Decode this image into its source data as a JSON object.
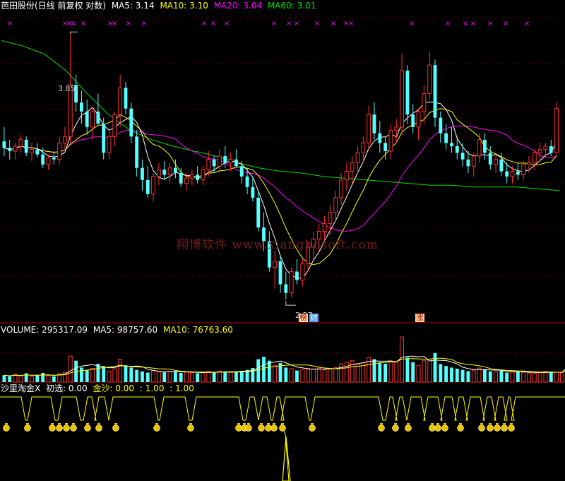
{
  "price_header": {
    "name": "芭田股份(日线 前复权 对数)",
    "ma5_label": "MA5: 3.14",
    "ma10_label": "MA10: 3.10",
    "ma20_label": "MA20: 3.04",
    "ma60_label": "MA60: 3.01"
  },
  "volume_header": {
    "volume_label": "VOLUME: 295317.09",
    "ma5_label": "MA5: 98757.60",
    "ma10_label": "MA10: 76763.60"
  },
  "indicator_header": {
    "name": "沙里淘金X",
    "chuxuan_label": "初选: 0.00",
    "jinsha_label": "金沙: 0.00",
    "val1_label": ": 1.00",
    "val2_label": ": 1.00"
  },
  "annotations": {
    "high_price": "3.85",
    "low_price": "2.27",
    "tag_bang": "榜",
    "tag_cai": "财",
    "tag_zhang": "涨"
  },
  "watermark": "翔博软件 www.xiangbosoft.com",
  "colors": {
    "up": "#ff3232",
    "down": "#54ffff",
    "ma5": "#ffffff",
    "ma10": "#ffff00",
    "ma20": "#ff00ff",
    "ma60": "#00e000",
    "grid": "#8b0000",
    "divider": "#b00000"
  },
  "chart_data": {
    "type": "candlestick",
    "log_scale": true,
    "y_high": 3.85,
    "y_low": 2.27,
    "candles": [
      [
        3.11,
        3.2,
        3.02,
        3.07
      ],
      [
        3.07,
        3.12,
        3.0,
        3.05
      ],
      [
        3.05,
        3.1,
        3.0,
        3.08
      ],
      [
        3.08,
        3.15,
        3.04,
        3.12
      ],
      [
        3.12,
        3.14,
        3.02,
        3.04
      ],
      [
        3.04,
        3.1,
        2.99,
        3.06
      ],
      [
        3.06,
        3.1,
        3.01,
        3.03
      ],
      [
        3.03,
        3.07,
        2.95,
        2.97
      ],
      [
        2.97,
        3.03,
        2.94,
        3.01
      ],
      [
        3.01,
        3.05,
        2.97,
        3.0
      ],
      [
        3.0,
        3.14,
        2.97,
        3.1
      ],
      [
        3.1,
        3.2,
        3.05,
        3.14
      ],
      [
        3.14,
        3.85,
        3.1,
        3.48
      ],
      [
        3.48,
        3.55,
        3.3,
        3.36
      ],
      [
        3.36,
        3.44,
        3.22,
        3.3
      ],
      [
        3.3,
        3.38,
        3.15,
        3.2
      ],
      [
        3.2,
        3.33,
        3.12,
        3.3
      ],
      [
        3.3,
        3.42,
        3.22,
        3.22
      ],
      [
        3.22,
        3.26,
        3.0,
        3.04
      ],
      [
        3.04,
        3.18,
        3.0,
        3.14
      ],
      [
        3.14,
        3.3,
        3.08,
        3.28
      ],
      [
        3.28,
        3.55,
        3.2,
        3.46
      ],
      [
        3.46,
        3.5,
        3.28,
        3.32
      ],
      [
        3.32,
        3.36,
        3.1,
        3.14
      ],
      [
        3.14,
        3.18,
        2.9,
        2.95
      ],
      [
        2.95,
        3.0,
        2.82,
        2.88
      ],
      [
        2.88,
        2.96,
        2.78,
        2.8
      ],
      [
        2.8,
        2.92,
        2.76,
        2.9
      ],
      [
        2.9,
        2.98,
        2.85,
        2.94
      ],
      [
        2.94,
        2.99,
        2.88,
        2.91
      ],
      [
        2.91,
        2.98,
        2.86,
        2.95
      ],
      [
        2.95,
        3.0,
        2.89,
        2.92
      ],
      [
        2.92,
        2.95,
        2.84,
        2.86
      ],
      [
        2.86,
        2.92,
        2.82,
        2.89
      ],
      [
        2.89,
        2.94,
        2.85,
        2.91
      ],
      [
        2.91,
        2.96,
        2.86,
        2.88
      ],
      [
        2.88,
        2.96,
        2.85,
        2.94
      ],
      [
        2.94,
        3.05,
        2.9,
        3.0
      ],
      [
        3.0,
        3.02,
        2.92,
        2.96
      ],
      [
        2.96,
        3.06,
        2.92,
        3.02
      ],
      [
        3.02,
        3.08,
        2.95,
        2.98
      ],
      [
        2.98,
        3.04,
        2.93,
        3.0
      ],
      [
        3.0,
        3.06,
        2.95,
        2.96
      ],
      [
        2.96,
        2.99,
        2.86,
        2.9
      ],
      [
        2.9,
        2.95,
        2.8,
        2.84
      ],
      [
        2.84,
        2.9,
        2.76,
        2.78
      ],
      [
        2.78,
        2.82,
        2.6,
        2.62
      ],
      [
        2.62,
        2.7,
        2.5,
        2.55
      ],
      [
        2.55,
        2.6,
        2.4,
        2.42
      ],
      [
        2.42,
        2.5,
        2.32,
        2.45
      ],
      [
        2.45,
        2.48,
        2.3,
        2.34
      ],
      [
        2.34,
        2.4,
        2.27,
        2.3
      ],
      [
        2.3,
        2.42,
        2.28,
        2.4
      ],
      [
        2.4,
        2.46,
        2.34,
        2.36
      ],
      [
        2.36,
        2.46,
        2.33,
        2.44
      ],
      [
        2.44,
        2.55,
        2.4,
        2.52
      ],
      [
        2.52,
        2.6,
        2.46,
        2.56
      ],
      [
        2.56,
        2.64,
        2.5,
        2.6
      ],
      [
        2.6,
        2.68,
        2.55,
        2.64
      ],
      [
        2.64,
        2.74,
        2.58,
        2.7
      ],
      [
        2.7,
        2.82,
        2.65,
        2.78
      ],
      [
        2.78,
        2.92,
        2.74,
        2.88
      ],
      [
        2.88,
        2.98,
        2.82,
        2.93
      ],
      [
        2.93,
        3.02,
        2.86,
        2.98
      ],
      [
        2.98,
        3.08,
        2.92,
        3.04
      ],
      [
        3.04,
        3.14,
        2.98,
        3.1
      ],
      [
        3.1,
        3.34,
        3.05,
        3.28
      ],
      [
        3.28,
        3.36,
        3.12,
        3.16
      ],
      [
        3.16,
        3.24,
        3.04,
        3.1
      ],
      [
        3.1,
        3.14,
        3.0,
        3.05
      ],
      [
        3.05,
        3.22,
        3.0,
        3.18
      ],
      [
        3.18,
        3.25,
        3.1,
        3.2
      ],
      [
        3.2,
        3.7,
        3.15,
        3.58
      ],
      [
        3.58,
        3.62,
        3.22,
        3.28
      ],
      [
        3.28,
        3.35,
        3.16,
        3.2
      ],
      [
        3.2,
        3.32,
        3.12,
        3.3
      ],
      [
        3.3,
        3.48,
        3.22,
        3.42
      ],
      [
        3.42,
        3.72,
        3.38,
        3.62
      ],
      [
        3.62,
        3.66,
        3.2,
        3.26
      ],
      [
        3.26,
        3.3,
        3.1,
        3.16
      ],
      [
        3.16,
        3.22,
        3.06,
        3.1
      ],
      [
        3.1,
        3.2,
        3.04,
        3.08
      ],
      [
        3.08,
        3.14,
        3.0,
        3.04
      ],
      [
        3.04,
        3.1,
        2.96,
        3.0
      ],
      [
        3.0,
        3.05,
        2.92,
        2.96
      ],
      [
        2.96,
        3.04,
        2.9,
        3.02
      ],
      [
        3.02,
        3.16,
        2.98,
        3.12
      ],
      [
        3.12,
        3.16,
        3.0,
        3.04
      ],
      [
        3.04,
        3.08,
        2.94,
        2.97
      ],
      [
        2.97,
        3.02,
        2.92,
        3.0
      ],
      [
        3.0,
        3.04,
        2.9,
        2.93
      ],
      [
        2.93,
        2.98,
        2.86,
        2.9
      ],
      [
        2.9,
        2.96,
        2.86,
        2.93
      ],
      [
        2.93,
        2.98,
        2.88,
        2.91
      ],
      [
        2.91,
        2.99,
        2.88,
        2.97
      ],
      [
        2.97,
        3.02,
        2.92,
        2.98
      ],
      [
        2.98,
        3.06,
        2.94,
        3.04
      ],
      [
        3.04,
        3.1,
        2.99,
        3.06
      ],
      [
        3.06,
        3.1,
        3.01,
        3.08
      ],
      [
        3.08,
        3.12,
        3.02,
        3.04
      ],
      [
        3.04,
        3.36,
        3.03,
        3.32
      ]
    ],
    "volume": [
      45,
      38,
      52,
      40,
      58,
      35,
      42,
      60,
      44,
      38,
      55,
      62,
      170,
      140,
      95,
      80,
      90,
      120,
      105,
      72,
      88,
      150,
      110,
      95,
      80,
      70,
      62,
      75,
      68,
      64,
      70,
      72,
      60,
      66,
      62,
      58,
      64,
      70,
      62,
      72,
      68,
      66,
      70,
      74,
      80,
      92,
      150,
      165,
      140,
      110,
      125,
      95,
      88,
      76,
      82,
      90,
      86,
      92,
      80,
      88,
      95,
      120,
      130,
      140,
      118,
      126,
      160,
      150,
      128,
      120,
      135,
      130,
      295,
      160,
      130,
      110,
      140,
      150,
      190,
      118,
      105,
      95,
      88,
      80,
      72,
      78,
      92,
      84,
      70,
      68,
      74,
      62,
      66,
      70,
      64,
      60,
      58,
      62,
      70,
      68,
      64,
      60,
      240
    ],
    "ma60_points": [
      [
        0,
        3.8
      ],
      [
        10,
        3.76
      ],
      [
        20,
        3.7
      ],
      [
        30,
        3.58
      ],
      [
        40,
        3.42
      ],
      [
        50,
        3.28
      ],
      [
        60,
        3.18
      ],
      [
        70,
        3.12
      ],
      [
        80,
        3.08
      ],
      [
        90,
        3.05
      ],
      [
        100,
        3.02
      ],
      [
        110,
        2.98
      ],
      [
        120,
        2.95
      ],
      [
        130,
        2.93
      ],
      [
        140,
        2.92
      ],
      [
        150,
        2.9
      ],
      [
        160,
        2.89
      ],
      [
        170,
        2.88
      ],
      [
        180,
        2.87
      ],
      [
        190,
        2.86
      ],
      [
        200,
        2.85
      ],
      [
        210,
        2.85
      ],
      [
        220,
        2.84
      ],
      [
        230,
        2.84
      ],
      [
        240,
        2.84
      ],
      [
        250,
        2.83
      ],
      [
        260,
        2.82
      ]
    ],
    "indicator_high_count": 49,
    "xuan_markers_count": 44,
    "top_marker_count": 32
  }
}
